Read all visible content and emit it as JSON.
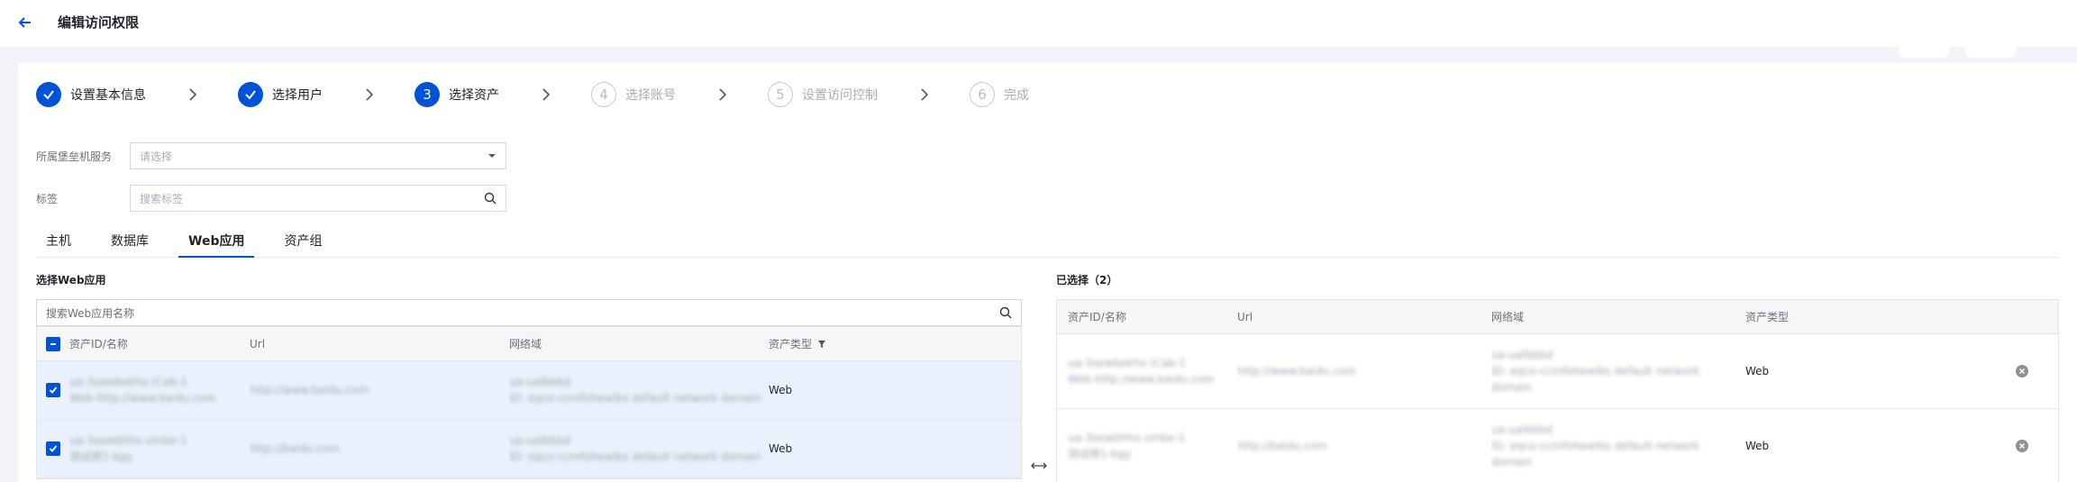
{
  "header": {
    "title": "编辑访问权限",
    "back_icon": "arrow-left-icon"
  },
  "steps": [
    {
      "num": "1",
      "label": "设置基本信息",
      "status": "done"
    },
    {
      "num": "2",
      "label": "选择用户",
      "status": "done"
    },
    {
      "num": "3",
      "label": "选择资产",
      "status": "active"
    },
    {
      "num": "4",
      "label": "选择账号",
      "status": "wait"
    },
    {
      "num": "5",
      "label": "设置访问控制",
      "status": "wait"
    },
    {
      "num": "6",
      "label": "完成",
      "status": "wait"
    }
  ],
  "form": {
    "service_label": "所属堡垒机服务",
    "service_placeholder": "请选择",
    "tag_label": "标签",
    "tag_placeholder": "搜索标签"
  },
  "tabs": [
    {
      "label": "主机",
      "active": false
    },
    {
      "label": "数据库",
      "active": false
    },
    {
      "label": "Web应用",
      "active": true
    },
    {
      "label": "资产组",
      "active": false
    }
  ],
  "left": {
    "title": "选择Web应用",
    "search_placeholder": "搜索Web应用名称",
    "columns": [
      "资产ID/名称",
      "Url",
      "网络域",
      "资产类型"
    ],
    "rows": [
      {
        "name_line1": "ua-3sewbekho (Cab-1",
        "name_line2": "Web-http://www.baidu.com",
        "url": "http://www.baidu.com",
        "domain_line1": "ua-ualbbbd",
        "domain_line2": "ID: eqco-ccmfohewibs default network domain",
        "type": "Web",
        "checked": true
      },
      {
        "name_line1": "ua-3sewbhho umbe-1",
        "name_line2": "测试用1-bgy",
        "url": "http://baidu.com",
        "domain_line1": "ua-ualbbbd",
        "domain_line2": "ID: eqco-ccmfohewibs default network domain",
        "type": "Web",
        "checked": true
      }
    ]
  },
  "right": {
    "title": "已选择（2）",
    "columns": [
      "资产ID/名称",
      "Url",
      "网络域",
      "资产类型"
    ],
    "rows": [
      {
        "name_line1": "ua-3sewbekho (Cab-1",
        "name_line2": "Web-http://www.baidu.com",
        "url": "http://www.baidu.com",
        "domain_line1": "ua-ualbbbd",
        "domain_line2": "ID: eqco-ccmfohewibs default network",
        "domain_line3": "domain",
        "type": "Web"
      },
      {
        "name_line1": "ua-3sewbhho umbe-1",
        "name_line2": "测试用1-bgy",
        "url": "http://baidu.com",
        "domain_line1": "ua-ualbbbd",
        "domain_line2": "ID: eqco-ccmfohewibs default network",
        "domain_line3": "domain",
        "type": "Web"
      }
    ]
  },
  "colors": {
    "primary": "#0052d9",
    "selected_row": "#ebf1fc",
    "inactive_step": "#a8adb4"
  }
}
